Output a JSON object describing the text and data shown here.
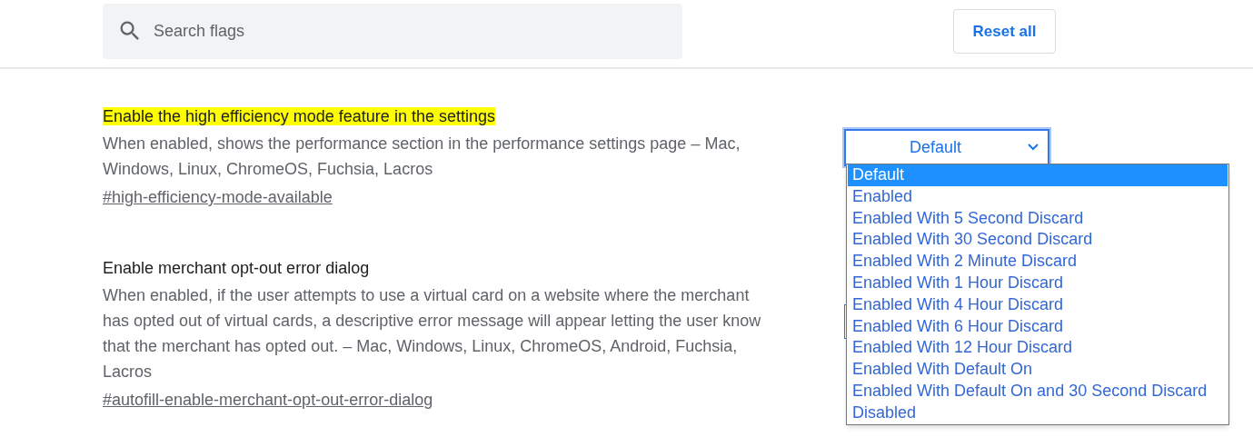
{
  "header": {
    "search": {
      "placeholder": "Search flags"
    },
    "reset_button": "Reset all"
  },
  "flags": [
    {
      "title": "Enable the high efficiency mode feature in the settings",
      "highlighted": true,
      "description": "When enabled, shows the performance section in the performance settings page – Mac, Windows, Linux, ChromeOS, Fuchsia, Lacros",
      "link": "#high-efficiency-mode-available",
      "select": {
        "value": "Default",
        "expanded": true,
        "options": [
          {
            "label": "Default",
            "selected": true
          },
          {
            "label": "Enabled",
            "selected": false
          },
          {
            "label": "Enabled With 5 Second Discard",
            "selected": false
          },
          {
            "label": "Enabled With 30 Second Discard",
            "selected": false
          },
          {
            "label": "Enabled With 2 Minute Discard",
            "selected": false
          },
          {
            "label": "Enabled With 1 Hour Discard",
            "selected": false
          },
          {
            "label": "Enabled With 4 Hour Discard",
            "selected": false
          },
          {
            "label": "Enabled With 6 Hour Discard",
            "selected": false
          },
          {
            "label": "Enabled With 12 Hour Discard",
            "selected": false
          },
          {
            "label": "Enabled With Default On",
            "selected": false
          },
          {
            "label": "Enabled With Default On and 30 Second Discard",
            "selected": false
          },
          {
            "label": "Disabled",
            "selected": false
          }
        ]
      }
    },
    {
      "title": "Enable merchant opt-out error dialog",
      "highlighted": false,
      "description": "When enabled, if the user attempts to use a virtual card on a website where the merchant has opted out of virtual cards, a descriptive error message will appear letting the user know that the merchant has opted out. – Mac, Windows, Linux, ChromeOS, Android, Fuchsia, Lacros",
      "link": "#autofill-enable-merchant-opt-out-error-dialog"
    }
  ]
}
